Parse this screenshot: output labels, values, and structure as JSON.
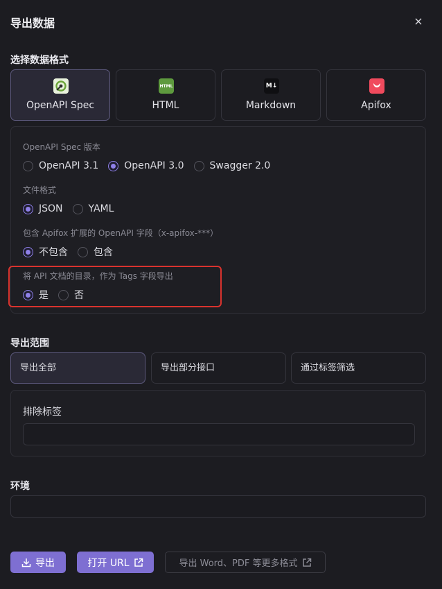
{
  "header": {
    "title": "导出数据",
    "close_symbol": "×"
  },
  "format_section": {
    "title": "选择数据格式",
    "cards": [
      {
        "label": "OpenAPI Spec",
        "icon": "openapi-icon",
        "icon_text": "",
        "selected": true
      },
      {
        "label": "HTML",
        "icon": "html-icon",
        "icon_text": "HTML",
        "selected": false
      },
      {
        "label": "Markdown",
        "icon": "markdown-icon",
        "icon_text": "M↓",
        "selected": false
      },
      {
        "label": "Apifox",
        "icon": "apifox-icon",
        "icon_text": "",
        "selected": false
      }
    ]
  },
  "options": {
    "spec_version": {
      "label": "OpenAPI Spec 版本",
      "choices": [
        "OpenAPI 3.1",
        "OpenAPI 3.0",
        "Swagger 2.0"
      ],
      "selected": "OpenAPI 3.0"
    },
    "file_format": {
      "label": "文件格式",
      "choices": [
        "JSON",
        "YAML"
      ],
      "selected": "JSON"
    },
    "apifox_ext": {
      "label": "包含 Apifox 扩展的 OpenAPI 字段（x-apifox-***）",
      "choices": [
        "不包含",
        "包含"
      ],
      "selected": "不包含"
    },
    "tags_export": {
      "label": "将 API 文档的目录，作为 Tags 字段导出",
      "choices": [
        "是",
        "否"
      ],
      "selected": "是"
    }
  },
  "scope_section": {
    "title": "导出范围",
    "buttons": [
      "导出全部",
      "导出部分接口",
      "通过标签筛选"
    ],
    "selected": "导出全部",
    "exclude_label": "排除标签",
    "exclude_value": ""
  },
  "env_section": {
    "title": "环境",
    "value": ""
  },
  "actions": {
    "export_label": "导出",
    "open_url_label": "打开 URL",
    "more_formats_label": "导出 Word、PDF 等更多格式"
  },
  "colors": {
    "accent": "#7e6fd2",
    "radio_checked": "#8f80e8",
    "highlight": "#d9332e",
    "background": "#1c1c21"
  }
}
